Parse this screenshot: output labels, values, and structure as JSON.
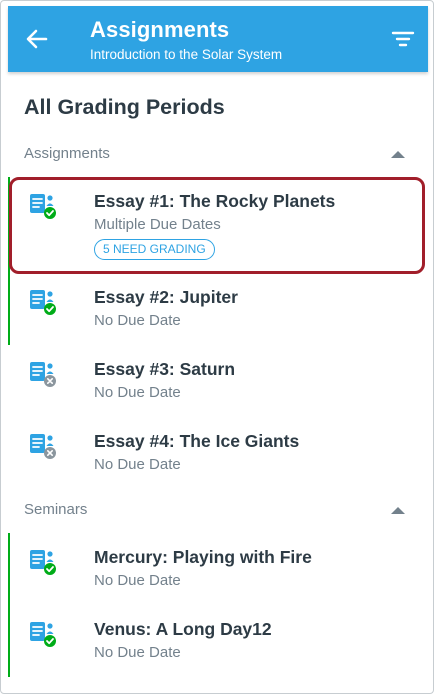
{
  "header": {
    "title": "Assignments",
    "subtitle": "Introduction to the Solar System",
    "accent_color": "#2ea3e3"
  },
  "grading_period": "All Grading Periods",
  "groups": [
    {
      "label": "Assignments",
      "expanded": true,
      "items": [
        {
          "title": "Essay #1: The Rocky Planets",
          "due": "Multiple Due Dates",
          "badge": "5 NEED GRADING",
          "published": true,
          "icon": "assignment-published-icon",
          "selected": true
        },
        {
          "title": "Essay #2: Jupiter",
          "due": "No Due Date",
          "published": true,
          "icon": "assignment-published-icon"
        },
        {
          "title": "Essay #3: Saturn",
          "due": "No Due Date",
          "published": false,
          "icon": "assignment-unpublished-icon"
        },
        {
          "title": "Essay #4: The Ice Giants",
          "due": "No Due Date",
          "published": false,
          "icon": "assignment-unpublished-icon"
        }
      ]
    },
    {
      "label": "Seminars",
      "expanded": true,
      "items": [
        {
          "title": "Mercury: Playing with Fire",
          "due": "No Due Date",
          "published": true,
          "icon": "assignment-published-icon"
        },
        {
          "title": "Venus: A Long Day12",
          "due": "No Due Date",
          "published": true,
          "icon": "assignment-published-icon"
        }
      ]
    }
  ],
  "colors": {
    "published": "#00ac18",
    "unpublished": "#8b969e",
    "highlight": "#a11e2a",
    "text": "#2d3b45",
    "muted": "#73818c"
  }
}
